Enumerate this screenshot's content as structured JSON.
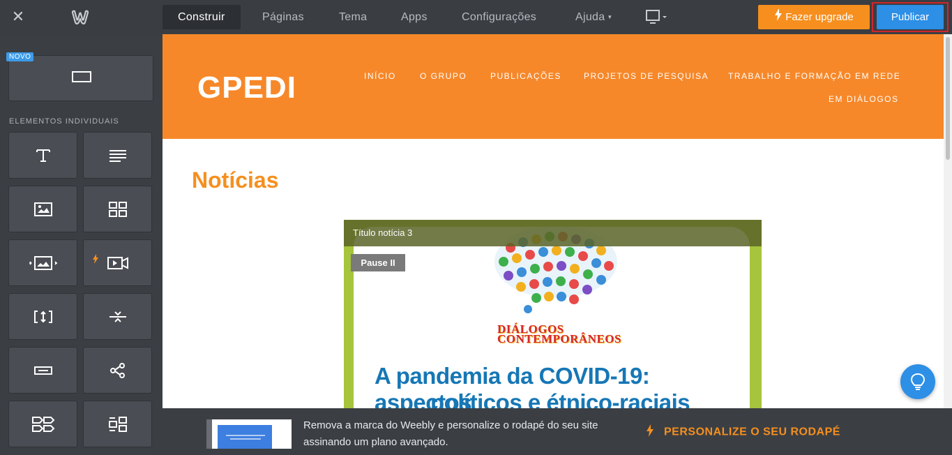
{
  "topbar": {
    "tabs": [
      {
        "label": "Construir",
        "active": true
      },
      {
        "label": "Páginas"
      },
      {
        "label": "Tema"
      },
      {
        "label": "Apps"
      },
      {
        "label": "Configurações"
      },
      {
        "label": "Ajuda"
      }
    ],
    "upgrade_label": "Fazer upgrade",
    "publish_label": "Publicar",
    "icons": [
      "close-icon",
      "weebly-logo-icon",
      "desktop-icon",
      "bolt-icon"
    ]
  },
  "sidebar": {
    "new_badge": "NOVO",
    "section_title": "ELEMENTOS INDIVIDUAIS",
    "tiles": [
      "title-icon",
      "text-icon",
      "image-icon",
      "gallery-icon",
      "slideshow-icon",
      "video-icon",
      "spacer-icon",
      "divider-icon",
      "button-icon",
      "social-icon",
      "form-icon",
      "columns-icon"
    ]
  },
  "site": {
    "title": "GPEDI",
    "nav": [
      "INÍCIO",
      "O GRUPO",
      "PUBLICAÇÕES",
      "PROJETOS DE PESQUISA",
      "TRABALHO E FORMAÇÃO EM REDE",
      "EM DIÁLOGOS"
    ],
    "heading": "Notícias",
    "slideshow": {
      "slide_title": "Título notícia 3",
      "pause_label": "Pause II",
      "logo_text": "DIÁLOGOS CONTEMPORÂNEOS",
      "headline_line1": "A pandemia da COVID-19: aspectos",
      "headline_line2": "políticos e étnico-raciais"
    }
  },
  "footer": {
    "text": "Remova a marca do Weebly e personalize o rodapé do seu site assinando um plano avançado.",
    "cta": "PERSONALIZE O SEU RODAPÉ"
  },
  "colors": {
    "accent_orange": "#f68f1e",
    "publish_blue": "#2d8fe5",
    "topbar": "#3a3d42"
  }
}
